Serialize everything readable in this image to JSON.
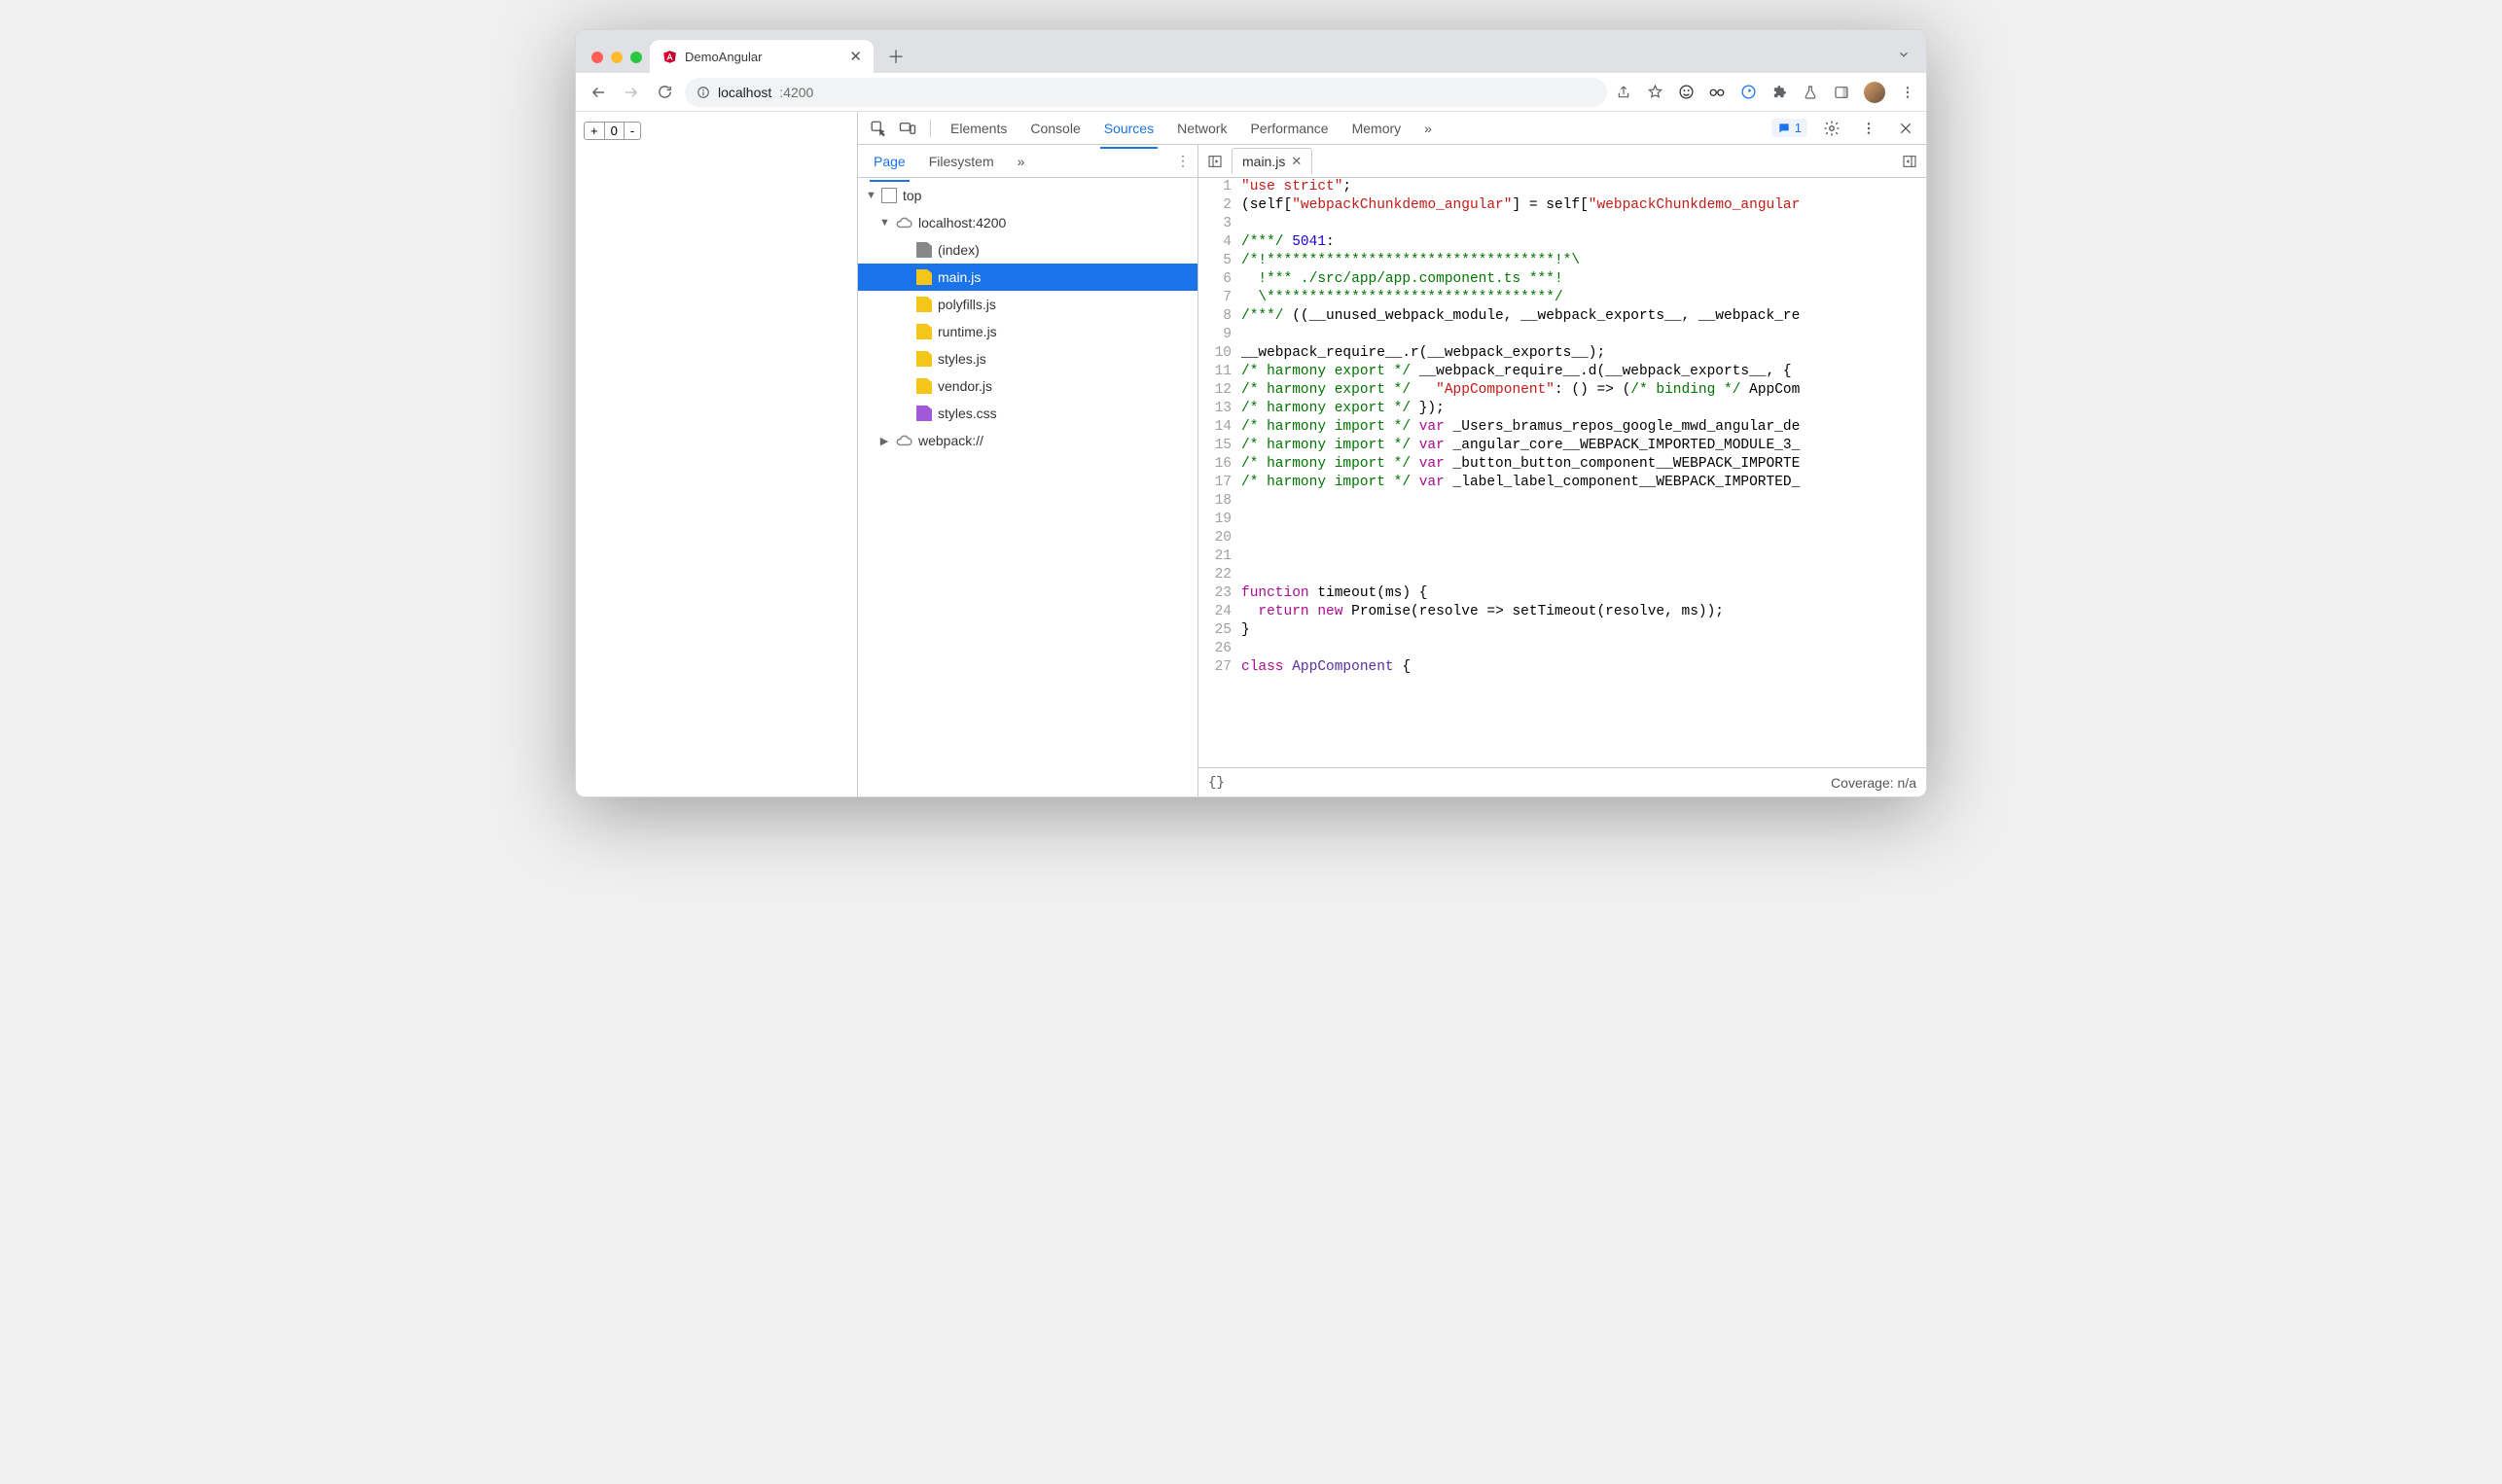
{
  "browser": {
    "tab_title": "DemoAngular",
    "url_host": "localhost",
    "url_port": ":4200"
  },
  "page": {
    "counter_value": "0",
    "plus": "+",
    "minus": "-"
  },
  "devtools": {
    "tabs": [
      "Elements",
      "Console",
      "Sources",
      "Network",
      "Performance",
      "Memory"
    ],
    "active_tab": "Sources",
    "more": "»",
    "issues_count": "1",
    "navigator_tabs": [
      "Page",
      "Filesystem"
    ],
    "navigator_active": "Page",
    "navigator_more": "»",
    "open_file": "main.js",
    "tree": {
      "top": "top",
      "origin": "localhost:4200",
      "files": [
        "(index)",
        "main.js",
        "polyfills.js",
        "runtime.js",
        "styles.js",
        "vendor.js",
        "styles.css"
      ],
      "webpack": "webpack://"
    },
    "statusbar": {
      "pretty": "{}",
      "coverage": "Coverage: n/a"
    },
    "code_lines": [
      [
        {
          "t": "\"use strict\"",
          "c": "c-str"
        },
        {
          "t": ";"
        }
      ],
      [
        {
          "t": "(self["
        },
        {
          "t": "\"webpackChunkdemo_angular\"",
          "c": "c-str"
        },
        {
          "t": "] = self["
        },
        {
          "t": "\"webpackChunkdemo_angular",
          "c": "c-str"
        }
      ],
      [
        {
          "t": ""
        }
      ],
      [
        {
          "t": "/***/",
          "c": "c-com"
        },
        {
          "t": " "
        },
        {
          "t": "5041",
          "c": "c-num"
        },
        {
          "t": ":"
        }
      ],
      [
        {
          "t": "/*!**********************************!*\\",
          "c": "c-com"
        }
      ],
      [
        {
          "t": "  !*** ./src/app/app.component.ts ***!",
          "c": "c-com"
        }
      ],
      [
        {
          "t": "  \\**********************************/",
          "c": "c-com"
        }
      ],
      [
        {
          "t": "/***/",
          "c": "c-com"
        },
        {
          "t": " ((__unused_webpack_module, __webpack_exports__, __webpack_re"
        }
      ],
      [
        {
          "t": ""
        }
      ],
      [
        {
          "t": "__webpack_require__.r(__webpack_exports__);"
        }
      ],
      [
        {
          "t": "/* harmony export */",
          "c": "c-com"
        },
        {
          "t": " __webpack_require__.d(__webpack_exports__, {"
        }
      ],
      [
        {
          "t": "/* harmony export */",
          "c": "c-com"
        },
        {
          "t": "   "
        },
        {
          "t": "\"AppComponent\"",
          "c": "c-str"
        },
        {
          "t": ": () => ("
        },
        {
          "t": "/* binding */",
          "c": "c-com"
        },
        {
          "t": " AppCom"
        }
      ],
      [
        {
          "t": "/* harmony export */",
          "c": "c-com"
        },
        {
          "t": " });"
        }
      ],
      [
        {
          "t": "/* harmony import */",
          "c": "c-com"
        },
        {
          "t": " "
        },
        {
          "t": "var",
          "c": "c-kw"
        },
        {
          "t": " _Users_bramus_repos_google_mwd_angular_de"
        }
      ],
      [
        {
          "t": "/* harmony import */",
          "c": "c-com"
        },
        {
          "t": " "
        },
        {
          "t": "var",
          "c": "c-kw"
        },
        {
          "t": " _angular_core__WEBPACK_IMPORTED_MODULE_3_"
        }
      ],
      [
        {
          "t": "/* harmony import */",
          "c": "c-com"
        },
        {
          "t": " "
        },
        {
          "t": "var",
          "c": "c-kw"
        },
        {
          "t": " _button_button_component__WEBPACK_IMPORTE"
        }
      ],
      [
        {
          "t": "/* harmony import */",
          "c": "c-com"
        },
        {
          "t": " "
        },
        {
          "t": "var",
          "c": "c-kw"
        },
        {
          "t": " _label_label_component__WEBPACK_IMPORTED_"
        }
      ],
      [
        {
          "t": ""
        }
      ],
      [
        {
          "t": ""
        }
      ],
      [
        {
          "t": ""
        }
      ],
      [
        {
          "t": ""
        }
      ],
      [
        {
          "t": ""
        }
      ],
      [
        {
          "t": "function",
          "c": "c-kw"
        },
        {
          "t": " timeout(ms) {"
        }
      ],
      [
        {
          "t": "  "
        },
        {
          "t": "return",
          "c": "c-kw"
        },
        {
          "t": " "
        },
        {
          "t": "new",
          "c": "c-kw"
        },
        {
          "t": " Promise(resolve => setTimeout(resolve, ms));"
        }
      ],
      [
        {
          "t": "}"
        }
      ],
      [
        {
          "t": ""
        }
      ],
      [
        {
          "t": "class",
          "c": "c-kw"
        },
        {
          "t": " "
        },
        {
          "t": "AppComponent",
          "c": "c-typ"
        },
        {
          "t": " {"
        }
      ]
    ]
  }
}
